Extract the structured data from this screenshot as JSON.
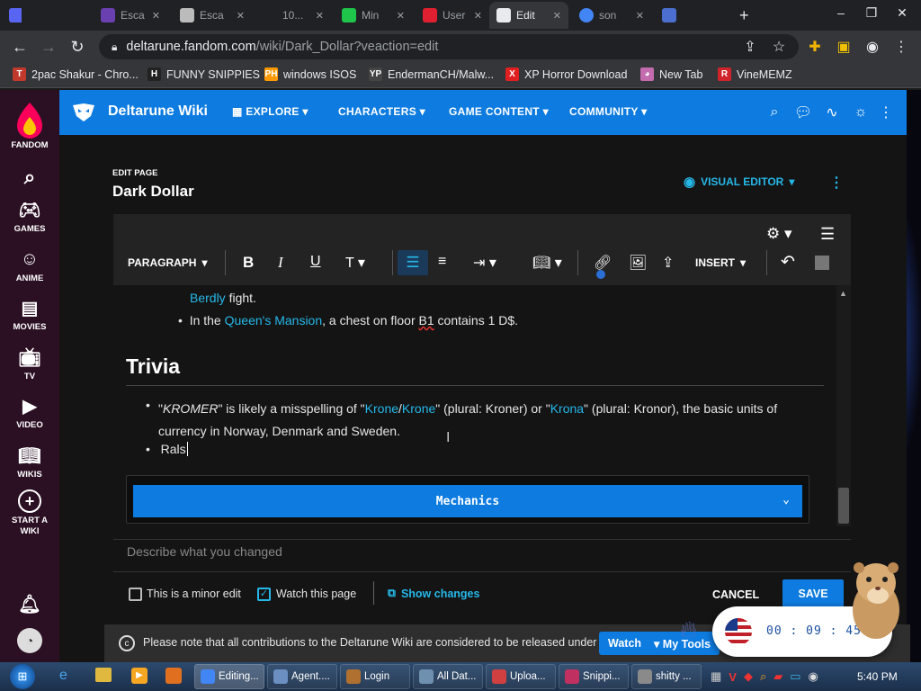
{
  "browser": {
    "tabs": [
      {
        "label": "Esca",
        "fav_color": "#6a3fb0"
      },
      {
        "label": "Esca",
        "fav_color": "#bbbbbb"
      },
      {
        "label": "10...",
        "fav_color": "#202124"
      },
      {
        "label": "Min",
        "fav_color": "#1fc44a"
      },
      {
        "label": "User",
        "fav_color": "#e02030"
      },
      {
        "label": "Edit",
        "fav_color": "#e8eaed"
      },
      {
        "label": "son",
        "fav_color": "#4285f4"
      }
    ],
    "url_host": "deltarune.fandom.com",
    "url_path": "/wiki/Dark_Dollar?veaction=edit"
  },
  "bookmarks": [
    {
      "label": "2pac Shakur - Chro...",
      "icon": "T",
      "color": "#c0392b"
    },
    {
      "label": "FUNNY SNIPPIES",
      "icon": "H",
      "color": "#222"
    },
    {
      "label": "windows ISOS",
      "icon": "PH",
      "color": "#ff9900"
    },
    {
      "label": "EndermanCH/Malw...",
      "icon": "YP",
      "color": "#444"
    },
    {
      "label": "XP Horror Download",
      "icon": "X",
      "color": "#e02020"
    },
    {
      "label": "New Tab",
      "icon": "◕",
      "color": "#c46bb0"
    },
    {
      "label": "VineMEMZ",
      "icon": "R",
      "color": "#d0242a"
    }
  ],
  "fandom_rail": [
    {
      "label": "FANDOM"
    },
    {
      "label": "GAMES"
    },
    {
      "label": "ANIME"
    },
    {
      "label": "MOVIES"
    },
    {
      "label": "TV"
    },
    {
      "label": "VIDEO"
    },
    {
      "label": "WIKIS"
    },
    {
      "label": "START A WIKI"
    }
  ],
  "wiki": {
    "name": "Deltarune Wiki",
    "nav": [
      "EXPLORE",
      "CHARACTERS",
      "GAME CONTENT",
      "COMMUNITY"
    ]
  },
  "edit": {
    "kicker": "EDIT PAGE",
    "title": "Dark Dollar",
    "visual_editor_label": "VISUAL EDITOR",
    "paragraph_label": "PARAGRAPH",
    "insert_label": "INSERT"
  },
  "content": {
    "prev_link": "Berdly",
    "prev_text": " fight.",
    "bullet_prefix": "In the ",
    "bullet_link": "Queen's Mansion",
    "bullet_suffix": ", a chest on floor ",
    "bullet_floor": "B1",
    "bullet_end": " contains 1 D$.",
    "heading": "Trivia",
    "trivia1_open": "\"",
    "trivia1_italic": "KROMER",
    "trivia1_mid": "\" is likely a misspelling of \"",
    "trivia1_link1": "Krone",
    "trivia1_slash": "/",
    "trivia1_link2": "Krone",
    "trivia1_mid2": "\" (plural: Kroner) or \"",
    "trivia1_link3": "Krona",
    "trivia1_end": "\" (plural: Kronor), the basic units of currency in Norway, Denmark and Sweden.",
    "trivia2": "Rals",
    "mechanics_label": "Mechanics"
  },
  "footer": {
    "summary_placeholder": "Describe what you changed",
    "minor_edit": "This is a minor edit",
    "watch_page": "Watch this page",
    "show_changes": "Show changes",
    "cancel": "CANCEL",
    "save": "SAVE",
    "notice": "Please note that all contributions to the Deltarune Wiki are considered to be released under",
    "watch": "Watch",
    "my_tools": "My Tools"
  },
  "recorder": {
    "timer": "00 : 09 : 45"
  },
  "taskbar": {
    "items": [
      {
        "label": "Editing...",
        "color": "#4285f4"
      },
      {
        "label": "Agent....",
        "color": "#6a8fc0"
      },
      {
        "label": "Login",
        "color": "#b07030"
      },
      {
        "label": "All Dat...",
        "color": "#7090b0"
      },
      {
        "label": "Uploa...",
        "color": "#d04040"
      },
      {
        "label": "Snippi...",
        "color": "#c03060"
      },
      {
        "label": "shitty ...",
        "color": "#8a8a8a"
      }
    ],
    "clock": "5:40 PM"
  },
  "colors": {
    "accent": "#0d7be0",
    "link": "#25b8e9",
    "fandom_rail": "#2b1023"
  }
}
